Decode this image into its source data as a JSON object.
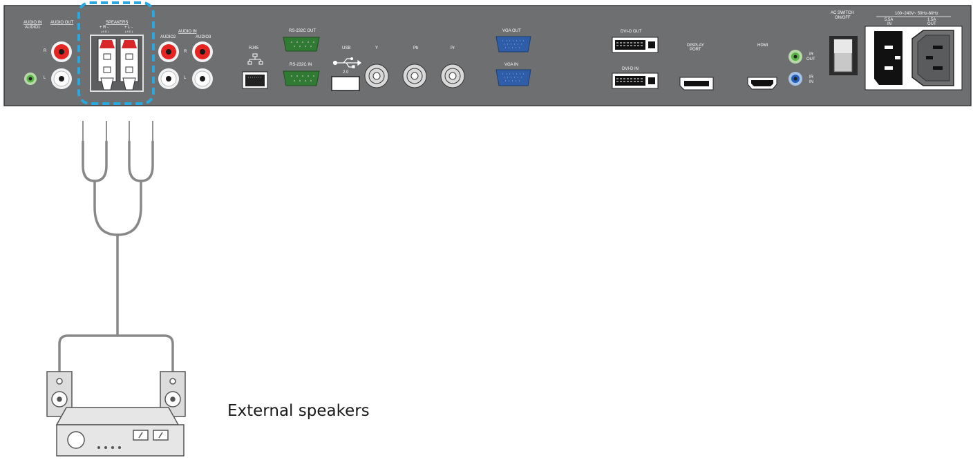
{
  "panel": {
    "color": "#6e6f71",
    "labels": {
      "audio_in": "AUDIO IN",
      "audio1": "AUDIO1",
      "audio_out": "AUDIO OUT",
      "speakers": "SPEAKERS",
      "speaker_r": "+ R -",
      "speaker_l": "+ L -",
      "speaker_r_ohm": "( 8 Ω )",
      "speaker_l_ohm": "( 8 Ω )",
      "audio_in_2": "AUDIO IN",
      "audio2": "AUDIO2",
      "audio3": "AUDIO3",
      "r": "R",
      "l": "L",
      "r2": "R",
      "l2": "L",
      "rj45": "RJ45",
      "rs232_out": "RS-232C OUT",
      "rs232_in": "RS-232C  IN",
      "usb": "USB",
      "usb_ver": "2.0",
      "y": "Y",
      "pb": "Pb",
      "pr": "Pr",
      "vga_out": "VGA OUT",
      "vga_in": "VGA IN",
      "dvi_out": "DVI-D OUT",
      "dvi_in": "DVI-D IN",
      "display": "DISPLAY",
      "port": "PORT",
      "hdmi": "HDMI",
      "ir": "IR",
      "out": "OUT",
      "ir2": "IR",
      "in": "IN",
      "ac_switch": "AC SWITCH",
      "on_off": "ON/OFF",
      "voltage": "100~240V~ 50Hz-60Hz",
      "in_amp": "5.5A",
      "in_lbl": "IN",
      "out_amp": "1.5A",
      "out_lbl": "OUT"
    }
  },
  "highlight_color": "#29a8e0",
  "caption": "External speakers"
}
